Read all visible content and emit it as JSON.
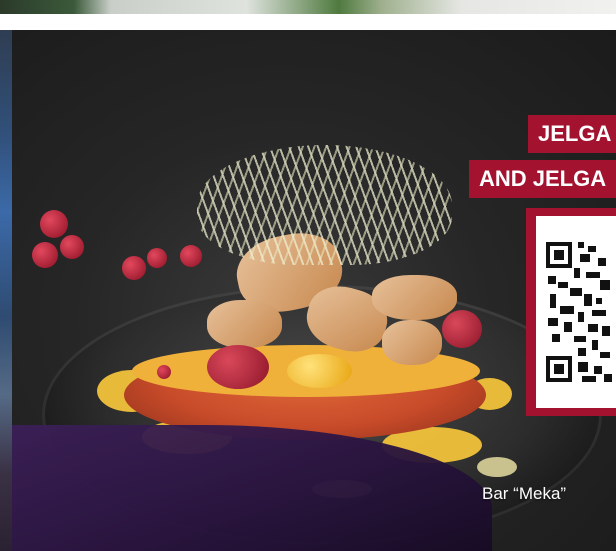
{
  "banner": {
    "line1": "JELGA",
    "line2": "AND JELGA"
  },
  "caption": "Bar “Meka”",
  "colors": {
    "accent_red": "#a31330",
    "sauce": "#f2c23a",
    "background_dark": "#1b1b1b"
  },
  "icons": {
    "qr": "qr-code-icon"
  }
}
